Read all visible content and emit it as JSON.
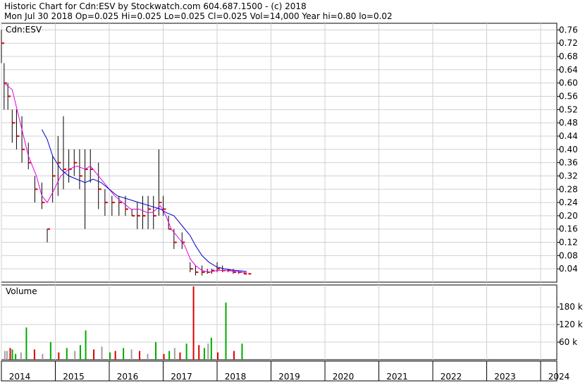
{
  "header": {
    "line1": "Historic Chart for Cdn:ESV by Stockwatch.com 604.687.1500 - (c) 2018",
    "line2": "Mon Jul 30 2018  Op=0.025  Hi=0.025  Lo=0.025  Cl=0.025  Vol=14,000  Year hi=0.80  lo=0.02"
  },
  "chart_data": [
    {
      "type": "line",
      "title": "Cdn:ESV",
      "ylim": [
        0.0,
        0.78
      ],
      "yticks": [
        "0.76",
        "0.72",
        "0.68",
        "0.64",
        "0.60",
        "0.56",
        "0.52",
        "0.48",
        "0.44",
        "0.40",
        "0.36",
        "0.32",
        "0.28",
        "0.24",
        "0.20",
        "0.16",
        "0.12",
        "0.08",
        "0.04"
      ],
      "ytick_values": [
        0.76,
        0.72,
        0.68,
        0.64,
        0.6,
        0.56,
        0.52,
        0.48,
        0.44,
        0.4,
        0.36,
        0.32,
        0.28,
        0.24,
        0.2,
        0.16,
        0.12,
        0.08,
        0.04
      ],
      "xlim": [
        2014.0,
        2024.3
      ],
      "xticks": [
        "2014",
        "2015",
        "2016",
        "2017",
        "2018",
        "2019",
        "2020",
        "2021",
        "2022",
        "2023",
        "2024"
      ],
      "xtick_values": [
        2014,
        2015,
        2016,
        2017,
        2018,
        2019,
        2020,
        2021,
        2022,
        2023,
        2024
      ],
      "grid": true,
      "colors": {
        "ohlc": "#000000",
        "close_tick": "#dd0000",
        "ma_short": "#e000e0",
        "ma_long": "#0000cc"
      },
      "ohlc": [
        {
          "t": 2014.0,
          "hi": 0.76,
          "lo": 0.66,
          "c": 0.72
        },
        {
          "t": 2014.05,
          "hi": 0.66,
          "lo": 0.52,
          "c": 0.6
        },
        {
          "t": 2014.12,
          "hi": 0.6,
          "lo": 0.52,
          "c": 0.56
        },
        {
          "t": 2014.2,
          "hi": 0.52,
          "lo": 0.42,
          "c": 0.48
        },
        {
          "t": 2014.28,
          "hi": 0.52,
          "lo": 0.4,
          "c": 0.44
        },
        {
          "t": 2014.38,
          "hi": 0.5,
          "lo": 0.36,
          "c": 0.4
        },
        {
          "t": 2014.5,
          "hi": 0.42,
          "lo": 0.34,
          "c": 0.36
        },
        {
          "t": 2014.62,
          "hi": 0.32,
          "lo": 0.24,
          "c": 0.28
        },
        {
          "t": 2014.75,
          "hi": 0.3,
          "lo": 0.22,
          "c": 0.24
        },
        {
          "t": 2014.85,
          "hi": 0.16,
          "lo": 0.12,
          "c": 0.16
        },
        {
          "t": 2014.95,
          "hi": 0.38,
          "lo": 0.24,
          "c": 0.32
        },
        {
          "t": 2015.05,
          "hi": 0.44,
          "lo": 0.26,
          "c": 0.36
        },
        {
          "t": 2015.15,
          "hi": 0.5,
          "lo": 0.28,
          "c": 0.34
        },
        {
          "t": 2015.25,
          "hi": 0.4,
          "lo": 0.3,
          "c": 0.34
        },
        {
          "t": 2015.35,
          "hi": 0.4,
          "lo": 0.32,
          "c": 0.36
        },
        {
          "t": 2015.45,
          "hi": 0.4,
          "lo": 0.28,
          "c": 0.32
        },
        {
          "t": 2015.55,
          "hi": 0.4,
          "lo": 0.16,
          "c": 0.34
        },
        {
          "t": 2015.65,
          "hi": 0.4,
          "lo": 0.3,
          "c": 0.34
        },
        {
          "t": 2015.8,
          "hi": 0.36,
          "lo": 0.22,
          "c": 0.28
        },
        {
          "t": 2015.92,
          "hi": 0.28,
          "lo": 0.2,
          "c": 0.24
        },
        {
          "t": 2016.05,
          "hi": 0.26,
          "lo": 0.2,
          "c": 0.24
        },
        {
          "t": 2016.18,
          "hi": 0.26,
          "lo": 0.2,
          "c": 0.24
        },
        {
          "t": 2016.3,
          "hi": 0.26,
          "lo": 0.2,
          "c": 0.22
        },
        {
          "t": 2016.42,
          "hi": 0.22,
          "lo": 0.2,
          "c": 0.2
        },
        {
          "t": 2016.52,
          "hi": 0.24,
          "lo": 0.16,
          "c": 0.2
        },
        {
          "t": 2016.62,
          "hi": 0.26,
          "lo": 0.16,
          "c": 0.2
        },
        {
          "t": 2016.72,
          "hi": 0.26,
          "lo": 0.16,
          "c": 0.22
        },
        {
          "t": 2016.82,
          "hi": 0.26,
          "lo": 0.16,
          "c": 0.2
        },
        {
          "t": 2016.92,
          "hi": 0.4,
          "lo": 0.2,
          "c": 0.24
        },
        {
          "t": 2017.0,
          "hi": 0.26,
          "lo": 0.2,
          "c": 0.22
        },
        {
          "t": 2017.1,
          "hi": 0.2,
          "lo": 0.16,
          "c": 0.16
        },
        {
          "t": 2017.2,
          "hi": 0.16,
          "lo": 0.1,
          "c": 0.12
        },
        {
          "t": 2017.35,
          "hi": 0.15,
          "lo": 0.1,
          "c": 0.12
        },
        {
          "t": 2017.5,
          "hi": 0.06,
          "lo": 0.03,
          "c": 0.04
        },
        {
          "t": 2017.6,
          "hi": 0.05,
          "lo": 0.02,
          "c": 0.03
        },
        {
          "t": 2017.72,
          "hi": 0.05,
          "lo": 0.02,
          "c": 0.03
        },
        {
          "t": 2017.82,
          "hi": 0.04,
          "lo": 0.025,
          "c": 0.03
        },
        {
          "t": 2017.9,
          "hi": 0.04,
          "lo": 0.025,
          "c": 0.035
        },
        {
          "t": 2018.0,
          "hi": 0.06,
          "lo": 0.03,
          "c": 0.04
        },
        {
          "t": 2018.1,
          "hi": 0.05,
          "lo": 0.03,
          "c": 0.035
        },
        {
          "t": 2018.2,
          "hi": 0.04,
          "lo": 0.03,
          "c": 0.035
        },
        {
          "t": 2018.3,
          "hi": 0.04,
          "lo": 0.025,
          "c": 0.03
        },
        {
          "t": 2018.4,
          "hi": 0.035,
          "lo": 0.025,
          "c": 0.03
        },
        {
          "t": 2018.5,
          "hi": 0.03,
          "lo": 0.025,
          "c": 0.025
        },
        {
          "t": 2018.58,
          "hi": 0.025,
          "lo": 0.025,
          "c": 0.025
        }
      ],
      "ma_short": [
        [
          2014.05,
          0.6
        ],
        [
          2014.2,
          0.58
        ],
        [
          2014.35,
          0.48
        ],
        [
          2014.5,
          0.38
        ],
        [
          2014.65,
          0.32
        ],
        [
          2014.75,
          0.26
        ],
        [
          2014.85,
          0.24
        ],
        [
          2014.95,
          0.27
        ],
        [
          2015.1,
          0.32
        ],
        [
          2015.25,
          0.34
        ],
        [
          2015.4,
          0.35
        ],
        [
          2015.55,
          0.34
        ],
        [
          2015.65,
          0.35
        ],
        [
          2015.8,
          0.32
        ],
        [
          2015.95,
          0.29
        ],
        [
          2016.1,
          0.26
        ],
        [
          2016.25,
          0.24
        ],
        [
          2016.4,
          0.22
        ],
        [
          2016.55,
          0.22
        ],
        [
          2016.7,
          0.21
        ],
        [
          2016.8,
          0.21
        ],
        [
          2016.95,
          0.23
        ],
        [
          2017.05,
          0.2
        ],
        [
          2017.15,
          0.16
        ],
        [
          2017.25,
          0.14
        ],
        [
          2017.4,
          0.11
        ],
        [
          2017.5,
          0.07
        ],
        [
          2017.6,
          0.05
        ],
        [
          2017.72,
          0.035
        ],
        [
          2017.85,
          0.03
        ],
        [
          2018.0,
          0.035
        ],
        [
          2018.15,
          0.035
        ],
        [
          2018.3,
          0.033
        ],
        [
          2018.45,
          0.03
        ],
        [
          2018.55,
          0.028
        ]
      ],
      "ma_long": [
        [
          2014.75,
          0.46
        ],
        [
          2014.85,
          0.43
        ],
        [
          2014.95,
          0.38
        ],
        [
          2015.1,
          0.34
        ],
        [
          2015.25,
          0.32
        ],
        [
          2015.4,
          0.31
        ],
        [
          2015.55,
          0.3
        ],
        [
          2015.7,
          0.31
        ],
        [
          2015.85,
          0.3
        ],
        [
          2016.0,
          0.28
        ],
        [
          2016.15,
          0.26
        ],
        [
          2016.35,
          0.25
        ],
        [
          2016.55,
          0.24
        ],
        [
          2016.75,
          0.23
        ],
        [
          2016.95,
          0.22
        ],
        [
          2017.05,
          0.21
        ],
        [
          2017.2,
          0.2
        ],
        [
          2017.35,
          0.17
        ],
        [
          2017.5,
          0.14
        ],
        [
          2017.6,
          0.11
        ],
        [
          2017.72,
          0.08
        ],
        [
          2017.85,
          0.06
        ],
        [
          2018.0,
          0.045
        ],
        [
          2018.15,
          0.04
        ],
        [
          2018.3,
          0.036
        ],
        [
          2018.45,
          0.034
        ],
        [
          2018.55,
          0.032
        ]
      ]
    },
    {
      "type": "bar",
      "title": "Volume",
      "ylim": [
        0,
        255
      ],
      "yticks": [
        "180 k",
        "120 k",
        "60 k"
      ],
      "ytick_values": [
        180,
        120,
        60
      ],
      "grid": true,
      "colors": {
        "up": "#00aa00",
        "down": "#dd0000",
        "flat": "#a0a0a0"
      },
      "x": [
        2014.05,
        2014.15,
        2014.25,
        2014.35,
        2014.45,
        2014.6,
        2014.75,
        2014.9,
        2015.05,
        2015.2,
        2015.35,
        2015.45,
        2015.55,
        2015.7,
        2015.85,
        2016.0,
        2016.1,
        2016.25,
        2016.4,
        2016.55,
        2016.7,
        2016.85,
        2017.0,
        2017.1,
        2017.2,
        2017.3,
        2017.42,
        2017.55,
        2017.65,
        2017.75,
        2017.82,
        2017.88,
        2018.0,
        2018.15,
        2018.3,
        2018.45
      ],
      "values": [
        30,
        40,
        20,
        25,
        110,
        35,
        20,
        60,
        25,
        40,
        30,
        50,
        100,
        35,
        45,
        25,
        30,
        40,
        35,
        30,
        20,
        60,
        20,
        30,
        40,
        25,
        55,
        250,
        50,
        40,
        55,
        75,
        25,
        195,
        30,
        55,
        30,
        35
      ],
      "direction": [
        "flat",
        "down",
        "up",
        "flat",
        "up",
        "down",
        "flat",
        "up",
        "down",
        "up",
        "flat",
        "up",
        "up",
        "down",
        "flat",
        "up",
        "down",
        "up",
        "flat",
        "down",
        "flat",
        "up",
        "down",
        "up",
        "flat",
        "down",
        "up",
        "down",
        "down",
        "up",
        "flat",
        "up",
        "down",
        "up",
        "down",
        "up",
        "flat",
        "up"
      ]
    }
  ]
}
